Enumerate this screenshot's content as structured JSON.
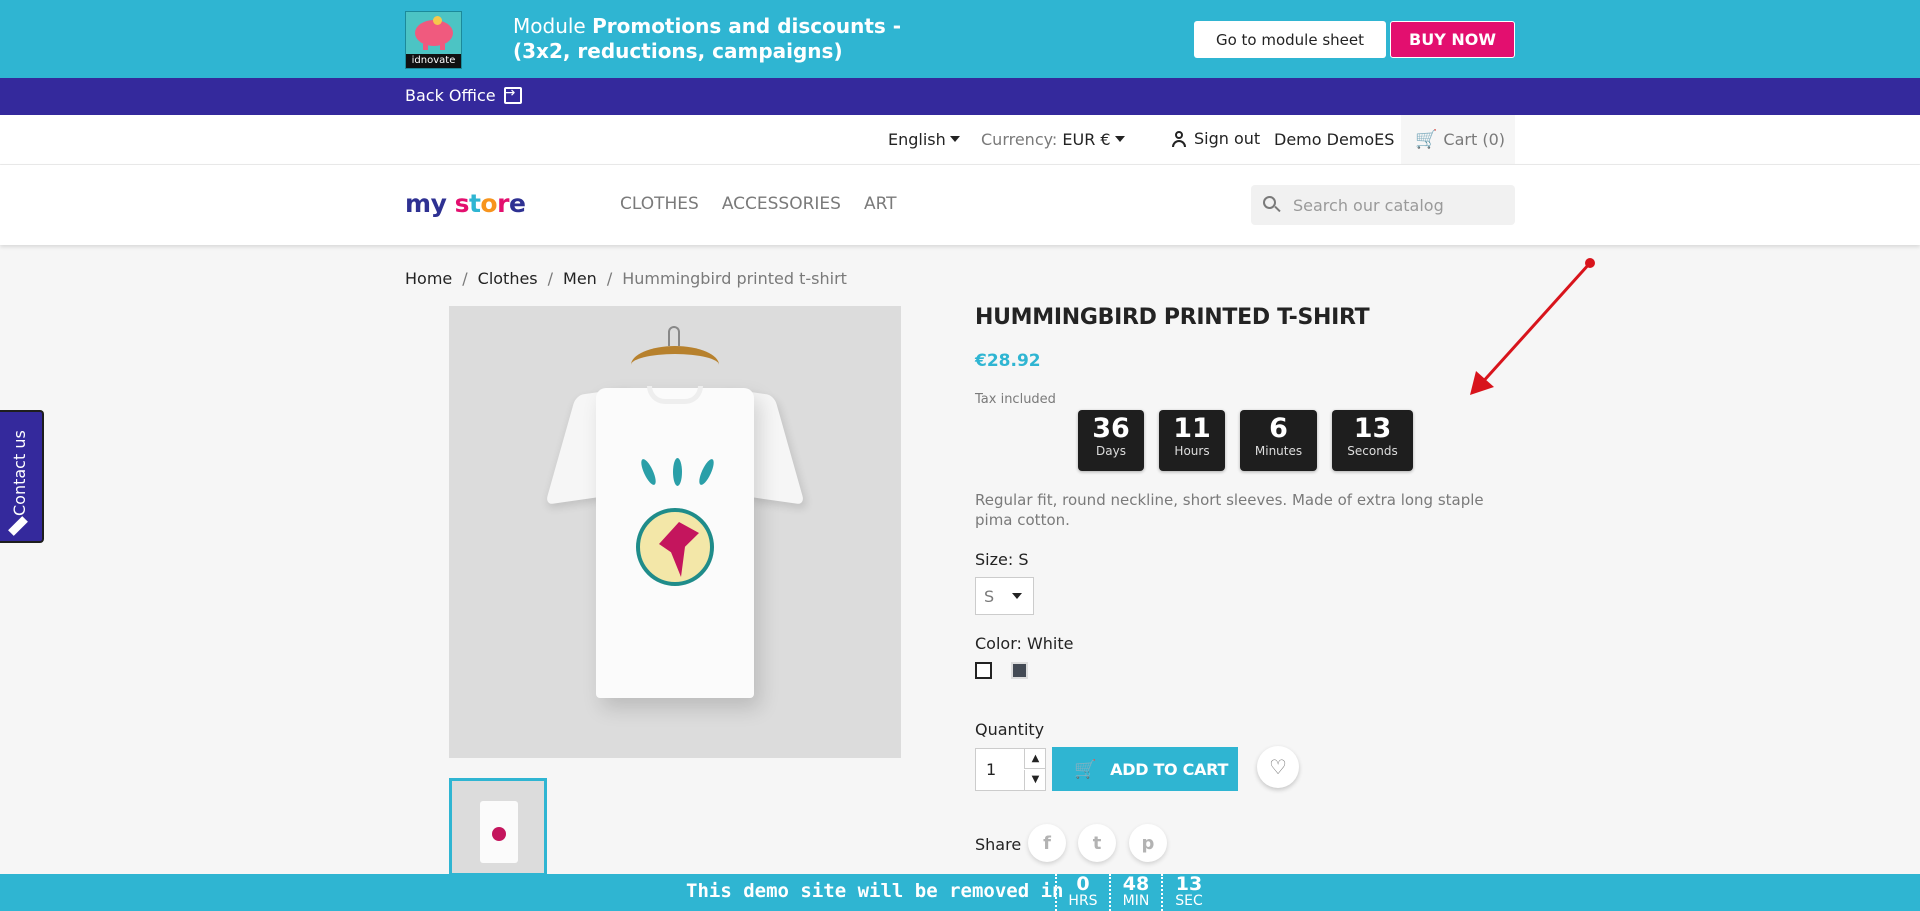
{
  "promo_bar": {
    "logo_text": "idnovate",
    "title_prefix": "Module ",
    "title_bold": "Promotions and discounts - (3x2, reductions, campaigns)",
    "module_sheet_button": "Go to module sheet",
    "buy_button": "BUY NOW",
    "colors": {
      "background": "#2fb5d2",
      "buy": "#e30f6f"
    }
  },
  "back_office": {
    "label": "Back Office",
    "icon": "exit-icon",
    "color": "#34299c"
  },
  "header": {
    "language": "English",
    "currency_label": "Currency:",
    "currency_value": "EUR €",
    "sign_out": "Sign out",
    "user_name": "Demo DemoES",
    "cart": "Cart (0)"
  },
  "nav": {
    "logo_letters": [
      "m",
      "y",
      " ",
      "s",
      "t",
      "o",
      "r",
      "e"
    ],
    "logo_colors": [
      "#2e3192",
      "#2e3192",
      "#ffffff",
      "#e30f6f",
      "#2fb5d2",
      "#f7941d",
      "#e30f6f",
      "#2e3192"
    ],
    "menu": [
      "CLOTHES",
      "ACCESSORIES",
      "ART"
    ],
    "search_placeholder": "Search our catalog"
  },
  "breadcrumb": {
    "items": [
      "Home",
      "Clothes",
      "Men"
    ],
    "separator": "/",
    "current": "Hummingbird printed t-shirt"
  },
  "product": {
    "name": "HUMMINGBIRD PRINTED T-SHIRT",
    "price": "€28.92",
    "tax_note": "Tax included",
    "description": "Regular fit, round neckline, short sleeves. Made of extra long staple pima cotton.",
    "size_label": "Size: S",
    "size_value": "S",
    "color_label": "Color: White",
    "color_swatches": [
      "#ffffff",
      "#434a54"
    ],
    "quantity_label": "Quantity",
    "quantity_value": "1",
    "add_to_cart": "ADD TO CART",
    "share_label": "Share",
    "share_icons": [
      "facebook-icon",
      "twitter-icon",
      "pinterest-icon"
    ]
  },
  "countdown": [
    {
      "value": "36",
      "label": "Days"
    },
    {
      "value": "11",
      "label": "Hours"
    },
    {
      "value": "6",
      "label": "Minutes"
    },
    {
      "value": "13",
      "label": "Seconds"
    }
  ],
  "contact_tab": {
    "label": "Contact us"
  },
  "demo_bar": {
    "text": "This demo site will be removed in",
    "countdown": [
      {
        "value": "0",
        "label": "HRS"
      },
      {
        "value": "48",
        "label": "MIN"
      },
      {
        "value": "13",
        "label": "SEC"
      }
    ]
  }
}
